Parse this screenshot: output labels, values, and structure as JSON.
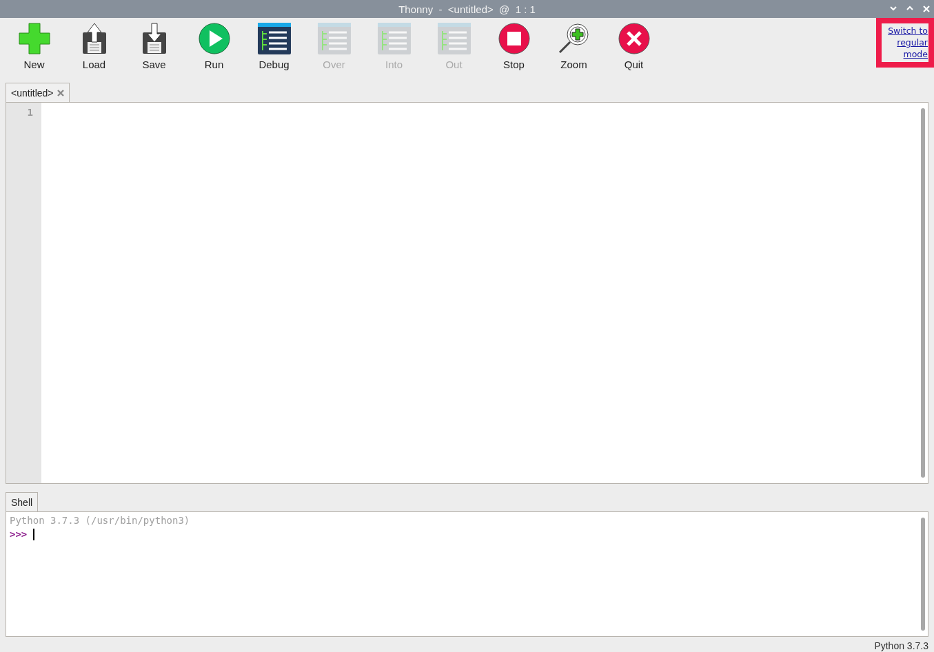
{
  "window": {
    "title": "Thonny  -  <untitled>  @  1 : 1"
  },
  "toolbar": [
    {
      "kind": "new",
      "label": "New",
      "disabled": false
    },
    {
      "kind": "load",
      "label": "Load",
      "disabled": false
    },
    {
      "kind": "save",
      "label": "Save",
      "disabled": false
    },
    {
      "kind": "run",
      "label": "Run",
      "disabled": false
    },
    {
      "kind": "debug",
      "label": "Debug",
      "disabled": false
    },
    {
      "kind": "over",
      "label": "Over",
      "disabled": true
    },
    {
      "kind": "into",
      "label": "Into",
      "disabled": true
    },
    {
      "kind": "out",
      "label": "Out",
      "disabled": true
    },
    {
      "kind": "stop",
      "label": "Stop",
      "disabled": false
    },
    {
      "kind": "zoom",
      "label": "Zoom",
      "disabled": false
    },
    {
      "kind": "quit",
      "label": "Quit",
      "disabled": false
    }
  ],
  "mode_link": "Switch to regular mode",
  "editor": {
    "tabs": [
      {
        "label": "<untitled>",
        "selected": true
      }
    ],
    "line_numbers": [
      "1"
    ]
  },
  "shell": {
    "tab": "Shell",
    "banner": "Python 3.7.3 (/usr/bin/python3)",
    "prompt": ">>>"
  },
  "status_bar": {
    "interpreter": "Python 3.7.3"
  }
}
